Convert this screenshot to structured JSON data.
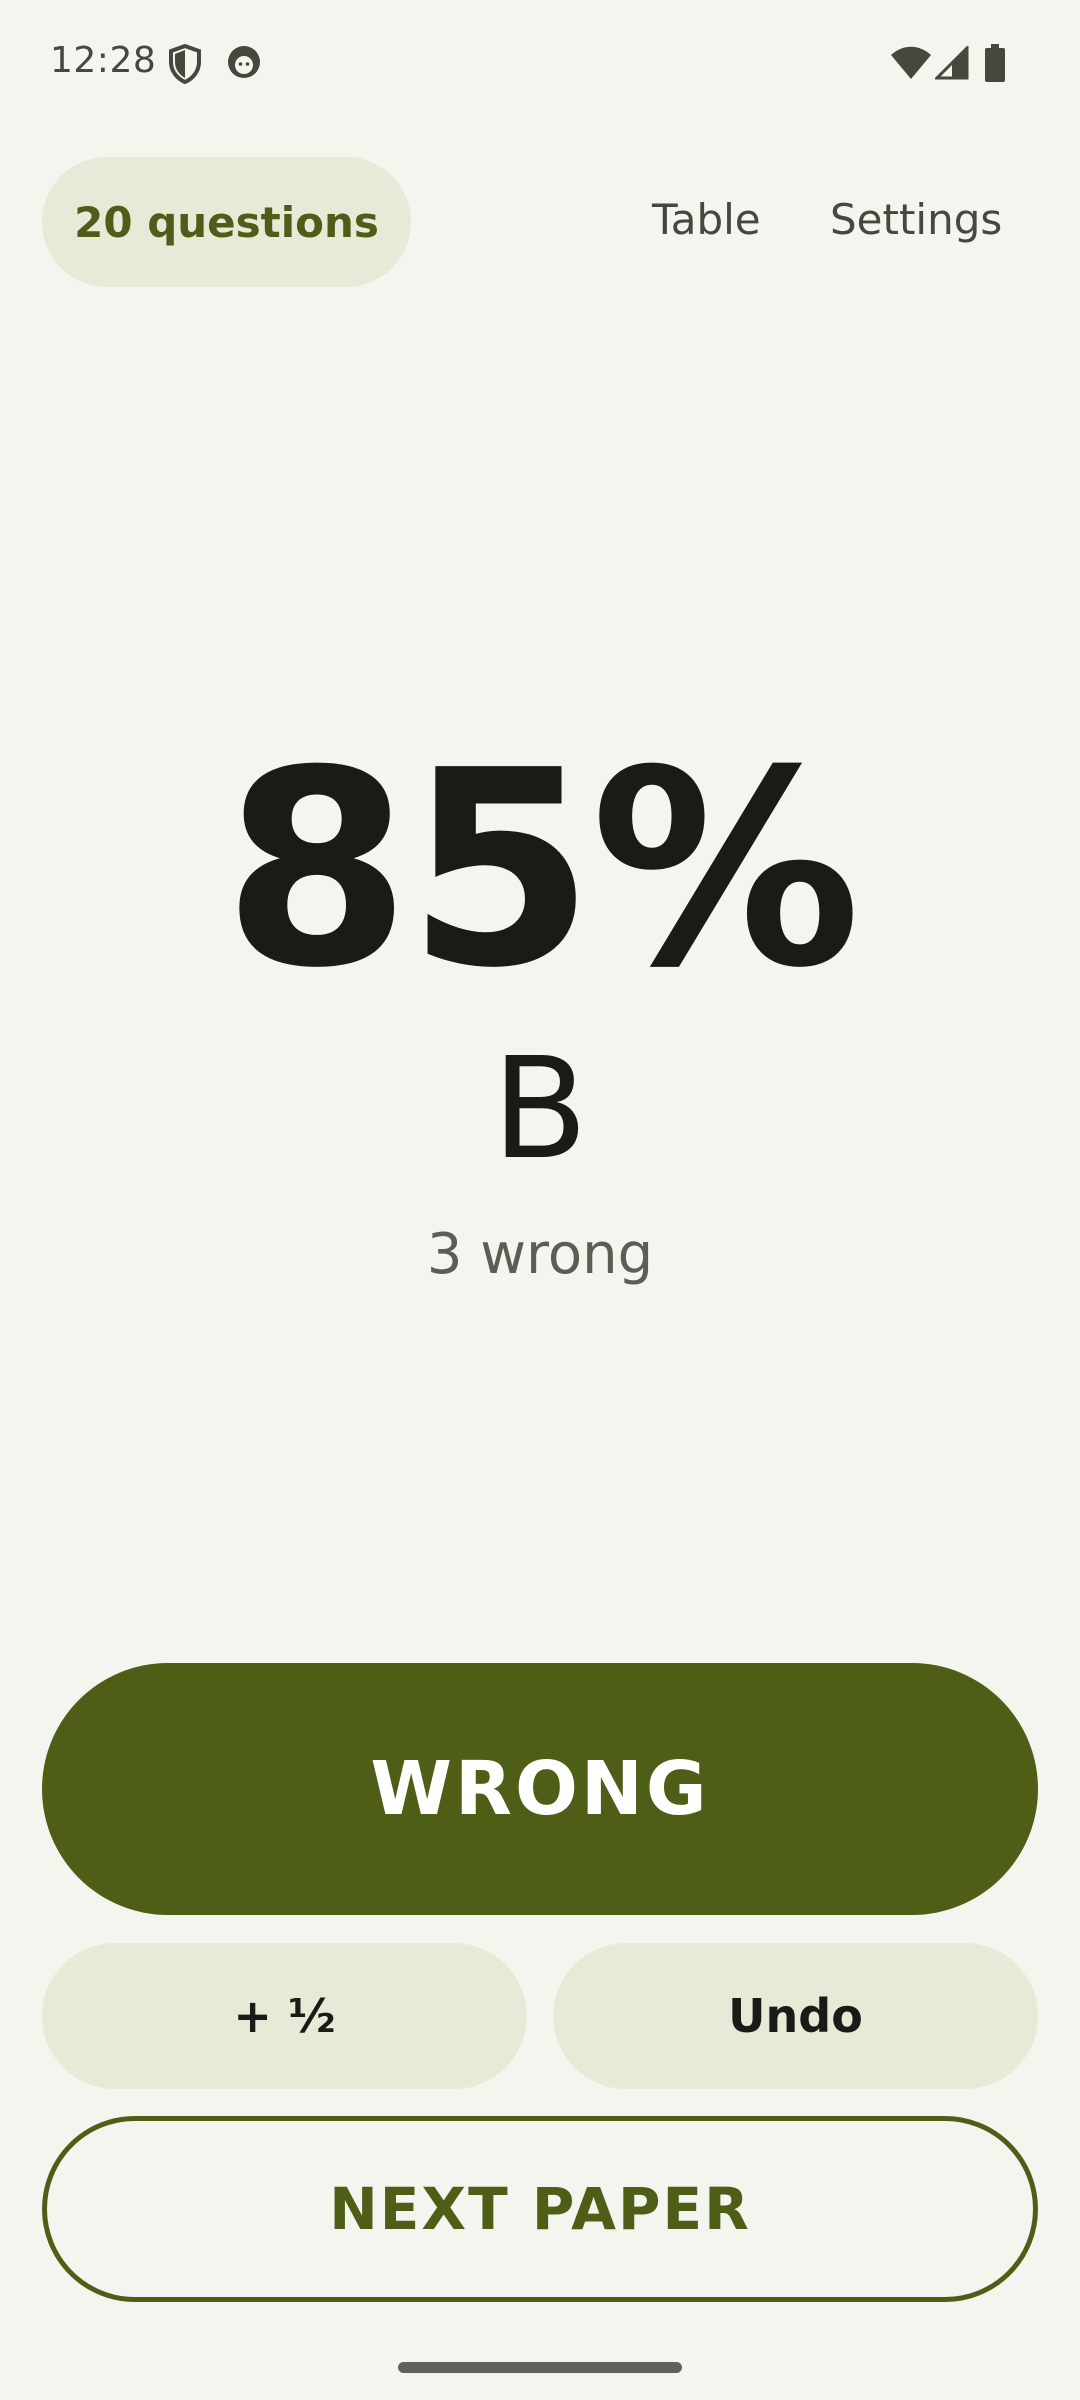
{
  "status_bar": {
    "time": "12:28",
    "icons": [
      "shield-icon",
      "cat-face-icon",
      "wifi-icon",
      "cell-signal-icon",
      "battery-icon"
    ]
  },
  "header": {
    "question_count": "20 questions",
    "table_label": "Table",
    "settings_label": "Settings"
  },
  "score": {
    "percent": "85%",
    "grade": "B",
    "wrong_count": "3 wrong"
  },
  "actions": {
    "wrong_label": "WRONG",
    "half_label": "+ ½",
    "undo_label": "Undo",
    "next_label": "NEXT PAPER"
  },
  "colors": {
    "background": "#f4f5ef",
    "primary": "#4e5e17",
    "chip": "#e7ead6",
    "on_surface": "#1a1b16",
    "secondary_text": "#5b5e55"
  }
}
